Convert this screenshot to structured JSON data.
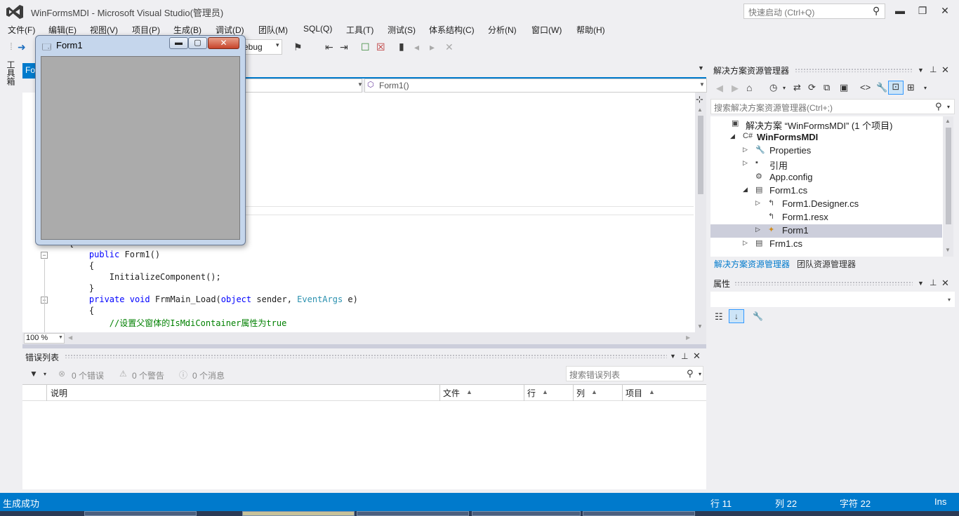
{
  "window": {
    "title": "WinFormsMDI - Microsoft Visual Studio(管理员)",
    "quick_launch_placeholder": "快速启动 (Ctrl+Q)",
    "minimize": "▬",
    "maximize": "❐",
    "close": "✕"
  },
  "menu": [
    "文件(F)",
    "编辑(E)",
    "视图(V)",
    "项目(P)",
    "生成(B)",
    "调试(D)",
    "团队(M)",
    "SQL(Q)",
    "工具(T)",
    "测试(S)",
    "体系结构(C)",
    "分析(N)",
    "窗口(W)",
    "帮助(H)"
  ],
  "toolbar": {
    "config": "ebug"
  },
  "left_strip": {
    "toolbox_label": "工具箱"
  },
  "editor": {
    "tab_label": "Fo",
    "member_dropdown": "Form1()",
    "zoom": "100 %"
  },
  "code_lines": [
    {
      "indent": "",
      "parts": [
        {
          "t": "{",
          "c": ""
        }
      ]
    },
    {
      "indent": "    ",
      "parts": [
        {
          "t": "public",
          "c": "kw"
        },
        {
          "t": " Form1()",
          "c": ""
        }
      ]
    },
    {
      "indent": "    ",
      "parts": [
        {
          "t": "{",
          "c": ""
        }
      ]
    },
    {
      "indent": "        ",
      "parts": [
        {
          "t": "InitializeComponent();",
          "c": ""
        }
      ]
    },
    {
      "indent": "    ",
      "parts": [
        {
          "t": "}",
          "c": ""
        }
      ]
    },
    {
      "indent": "    ",
      "parts": [
        {
          "t": "private",
          "c": "kw"
        },
        {
          "t": " ",
          "c": ""
        },
        {
          "t": "void",
          "c": "kw"
        },
        {
          "t": " FrmMain_Load(",
          "c": ""
        },
        {
          "t": "object",
          "c": "kw"
        },
        {
          "t": " sender, ",
          "c": ""
        },
        {
          "t": "EventArgs",
          "c": "ty"
        },
        {
          "t": " e)",
          "c": ""
        }
      ]
    },
    {
      "indent": "    ",
      "parts": [
        {
          "t": "{",
          "c": ""
        }
      ]
    },
    {
      "indent": "        ",
      "parts": [
        {
          "t": "//设置父窗体的IsMdiContainer属性为true",
          "c": "cm"
        }
      ]
    }
  ],
  "mdi_form": {
    "title": "Form1"
  },
  "error_list": {
    "title": "错误列表",
    "errors": "0 个错误",
    "warnings": "0 个警告",
    "messages": "0 个消息",
    "search_placeholder": "搜索错误列表",
    "columns": [
      "说明",
      "文件",
      "行",
      "列",
      "项目"
    ]
  },
  "solution_explorer": {
    "title": "解决方案资源管理器",
    "search_placeholder": "搜索解决方案资源管理器(Ctrl+;)",
    "items": [
      {
        "label": "解决方案 “WinFormsMDI” (1 个项目)",
        "level": 0,
        "expander": "",
        "icon": "▣",
        "bold": false
      },
      {
        "label": "WinFormsMDI",
        "level": 1,
        "expander": "◢",
        "icon": "C#",
        "bold": true
      },
      {
        "label": "Properties",
        "level": 2,
        "expander": "▷",
        "icon": "🔧",
        "bold": false
      },
      {
        "label": "引用",
        "level": 2,
        "expander": "▷",
        "icon": "▪",
        "bold": false
      },
      {
        "label": "App.config",
        "level": 2,
        "expander": "",
        "icon": "⚙",
        "bold": false
      },
      {
        "label": "Form1.cs",
        "level": 2,
        "expander": "◢",
        "icon": "▤",
        "bold": false
      },
      {
        "label": "Form1.Designer.cs",
        "level": 3,
        "expander": "▷",
        "icon": "↰",
        "bold": false
      },
      {
        "label": "Form1.resx",
        "level": 3,
        "expander": "",
        "icon": "↰",
        "bold": false
      },
      {
        "label": "Form1",
        "level": 3,
        "expander": "▷",
        "icon": "✦",
        "bold": false
      },
      {
        "label": "Frm1.cs",
        "level": 2,
        "expander": "▷",
        "icon": "▤",
        "bold": false
      }
    ],
    "tabs": [
      "解决方案资源管理器",
      "团队资源管理器"
    ]
  },
  "properties": {
    "title": "属性"
  },
  "status": {
    "left": "生成成功",
    "line": "行 11",
    "col": "列 22",
    "char": "字符 22",
    "mode": "Ins"
  }
}
